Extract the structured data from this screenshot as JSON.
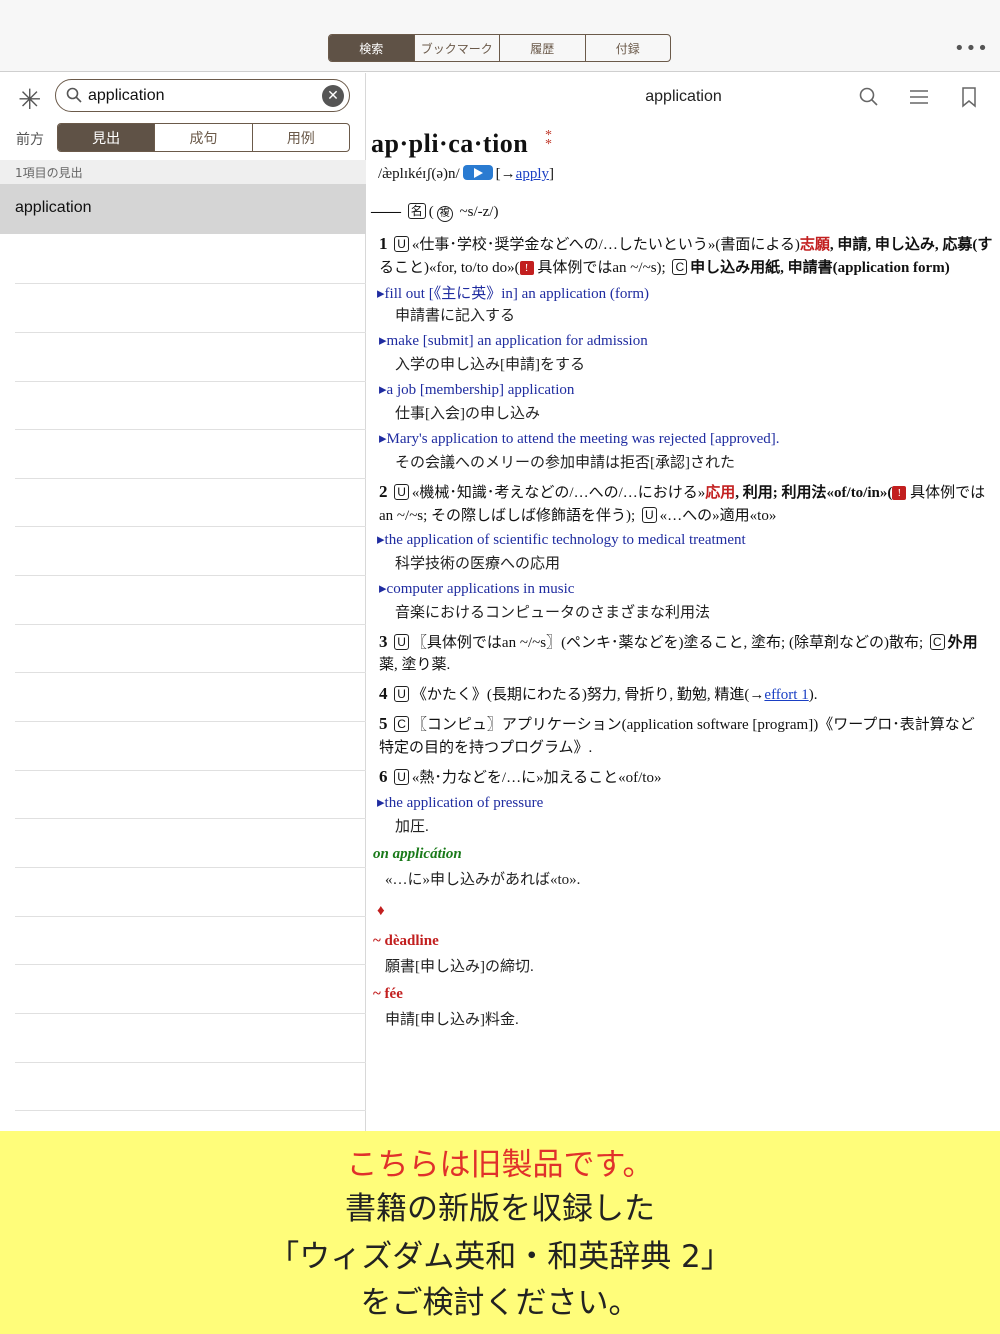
{
  "top_tabs": [
    "検索",
    "ブックマーク",
    "履歴",
    "付録"
  ],
  "top_active_tab": "検索",
  "more_label": "•••",
  "search": {
    "value": "application",
    "mode_label": "前方",
    "modes": [
      "見出",
      "成句",
      "用例"
    ]
  },
  "results": {
    "header": "1項目の見出",
    "items": [
      "application"
    ]
  },
  "entry": {
    "title": "application",
    "headword": "ap·pli·ca·tion",
    "pron": "/æ̀plɪkéɪʃ(ə)n/",
    "apply_link": "apply",
    "pos": "名",
    "plural": "複",
    "plural_form": "~s/-z/)",
    "s1": {
      "num": "1",
      "text_a": "«仕事･学校･奨学金などへの/…したいという»(書面による)",
      "red": "志願",
      "text_b": ", 申請, 申し込み, 応募(す",
      "text_c": "ること)«for, to/to do»(",
      "text_d": " 具体例ではan ~/~s);",
      "text_e": "申し込み用紙, 申請書(application form)"
    },
    "ex1": {
      "en": "fill out [《主に英》in] an application (form)",
      "ja": "申請書に記入する"
    },
    "ex2": {
      "en": "make [submit] an application for admission",
      "ja": "入学の申し込み[申請]をする"
    },
    "ex3": {
      "en": "a job [membership] application",
      "ja": "仕事[入会]の申し込み"
    },
    "ex4": {
      "en": "Mary's application to attend the meeting was rejected [approved].",
      "ja": "その会議へのメリーの参加申請は拒否[承認]された"
    },
    "s2": {
      "num": "2",
      "text_a": "«機械･知識･考えなどの/…への/…における»",
      "red": "応用",
      "text_b": ", 利用; 利用法«of/to/in»(",
      "text_c": " 具体例では",
      "text_d": "an ~/~s; その際しばしば修飾語を伴う);",
      "text_e": "«…への»適用«to»"
    },
    "ex5": {
      "en": "the application of scientific technology to medical treatment",
      "ja": "科学技術の医療への応用"
    },
    "ex6": {
      "en": "computer applications in music",
      "ja": "音楽におけるコンピュータのさまざまな利用法"
    },
    "s3": {
      "num": "3",
      "text_a": "〖具体例ではan ~/~s〗(ペンキ･薬などを)塗ること, 塗布; (除草剤などの)散布;",
      "text_b": "外用",
      "text_c": "薬, 塗り薬."
    },
    "s4": {
      "num": "4",
      "text_a": "《かたく》(長期にわたる)努力, 骨折り, 勤勉, 精進(→",
      "link": "effort 1",
      "text_b": ")."
    },
    "s5": {
      "num": "5",
      "text_a": "〖コンピュ〗アプリケーション(application software [program])《ワープロ･表計算など",
      "text_b": "特定の目的を持つプログラム》."
    },
    "s6": {
      "num": "6",
      "text_a": "«熱･力などを/…に»加えること«of/to»"
    },
    "ex7": {
      "en": "the application of pressure",
      "ja": "加圧."
    },
    "idiom": {
      "phrase": "on applicátion",
      "ja": "«…に»申し込みがあれば«to»."
    },
    "diamond": "♦",
    "comp1": {
      "head": "~ dèadline",
      "ja": "願書[申し込み]の締切."
    },
    "comp2": {
      "head": "~ fée",
      "ja": "申請[申し込み]料金."
    }
  },
  "banner": {
    "line1": "こちらは旧製品です。",
    "line2": "書籍の新版を収録した",
    "line3": "「ウィズダム英和・和英辞典 2」",
    "line4": "をご検討ください。"
  }
}
